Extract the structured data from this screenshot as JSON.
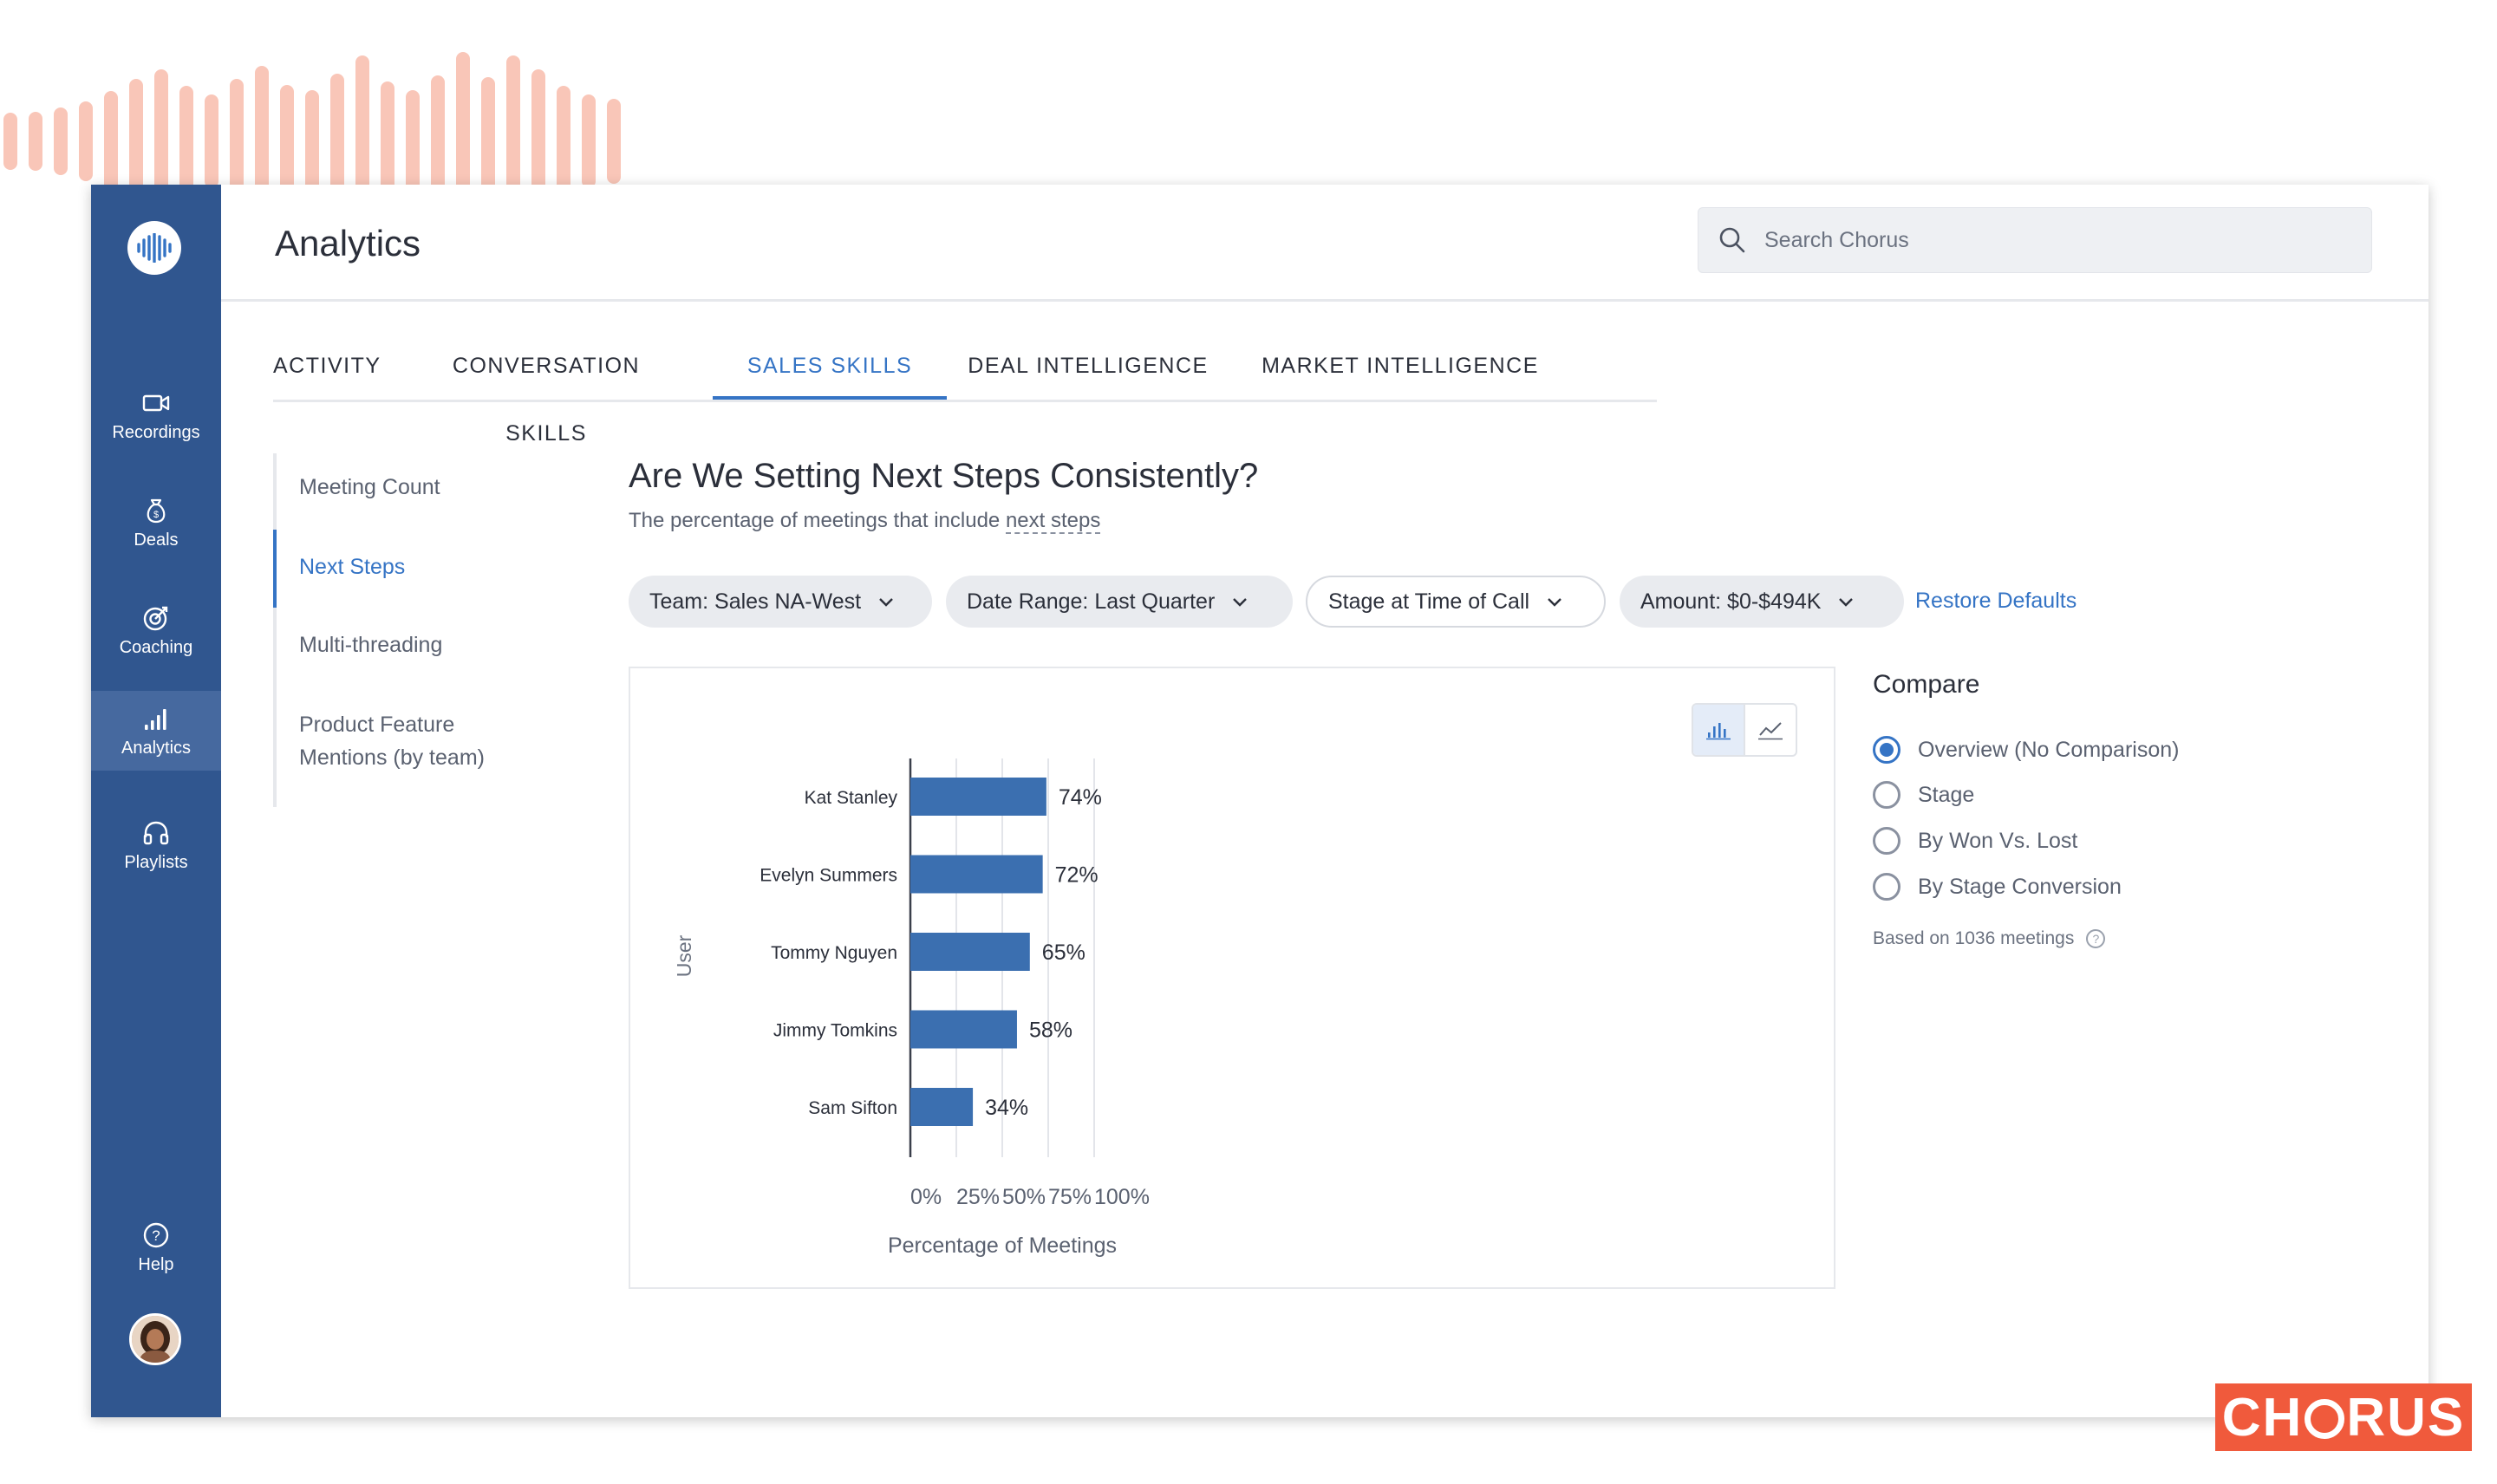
{
  "app": {
    "page_title": "Analytics",
    "search_placeholder": "Search Chorus",
    "brand_text_left": "CH",
    "brand_text_right": "RUS"
  },
  "sidebar": {
    "items": [
      {
        "label": "Recordings",
        "icon": "video-camera-icon"
      },
      {
        "label": "Deals",
        "icon": "money-bag-icon"
      },
      {
        "label": "Coaching",
        "icon": "target-icon"
      },
      {
        "label": "Analytics",
        "icon": "bar-chart-icon",
        "active": true
      },
      {
        "label": "Playlists",
        "icon": "headphones-icon"
      }
    ],
    "help_label": "Help"
  },
  "tabs": [
    {
      "label": "ACTIVITY"
    },
    {
      "label": "CONVERSATION SKILLS"
    },
    {
      "label": "SALES SKILLS",
      "active": true
    },
    {
      "label": "DEAL INTELLIGENCE"
    },
    {
      "label": "MARKET INTELLIGENCE"
    }
  ],
  "sub_nav": [
    {
      "label": "Meeting Count"
    },
    {
      "label": "Next Steps",
      "active": true
    },
    {
      "label": "Multi-threading"
    },
    {
      "label": "Product Feature\nMentions (by team)"
    }
  ],
  "question": {
    "title": "Are We Setting Next Steps Consistently?",
    "subtitle_prefix": "The percentage of meetings that include ",
    "subtitle_link": "next steps"
  },
  "filters": [
    {
      "label": "Team: Sales NA-West"
    },
    {
      "label": "Date Range: Last Quarter"
    },
    {
      "label": "Stage at Time of Call"
    },
    {
      "label": "Amount: $0-$494K"
    }
  ],
  "restore_label": "Restore Defaults",
  "compare": {
    "title": "Compare",
    "options": [
      {
        "label": "Overview (No Comparison)",
        "selected": true
      },
      {
        "label": "Stage",
        "selected": false
      },
      {
        "label": "By Won Vs. Lost",
        "selected": false
      },
      {
        "label": "By Stage Conversion",
        "selected": false
      }
    ],
    "based_on": "Based on 1036 meetings"
  },
  "colors": {
    "sidebar": "#30568f",
    "accent": "#3574c5",
    "bar": "#3b6fb0",
    "brand": "#f05a3c",
    "wave": "#f9c6b8"
  },
  "chart_data": {
    "type": "bar",
    "orientation": "horizontal",
    "categories": [
      "Kat Stanley",
      "Evelyn Summers",
      "Tommy Nguyen",
      "Jimmy Tomkins",
      "Sam Sifton"
    ],
    "values": [
      74,
      72,
      65,
      58,
      34
    ],
    "value_labels": [
      "74%",
      "72%",
      "65%",
      "58%",
      "34%"
    ],
    "xlabel": "Percentage of Meetings",
    "ylabel": "User",
    "xlim": [
      0,
      100
    ],
    "x_ticks": [
      0,
      25,
      50,
      75,
      100
    ],
    "x_tick_labels": [
      "0%",
      "25%",
      "50%",
      "75%",
      "100%"
    ],
    "grid": true
  }
}
